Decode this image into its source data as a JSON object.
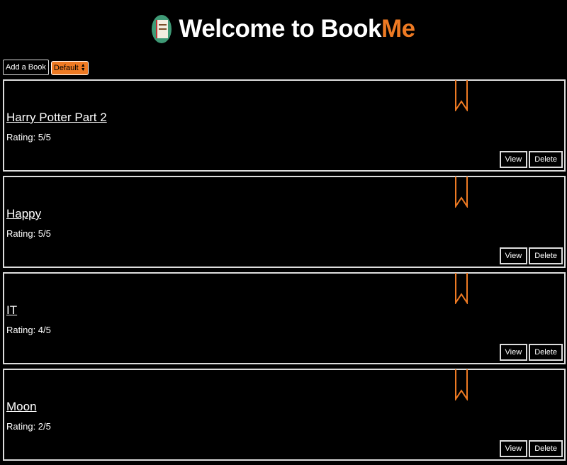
{
  "header": {
    "title_prefix": "Welcome to Book",
    "title_accent": "Me",
    "logo_icon": "book-logo-icon"
  },
  "controls": {
    "add_label": "Add a Book",
    "sort_value": "Default"
  },
  "books": [
    {
      "title": "Harry Potter Part 2",
      "rating": "Rating: 5/5",
      "view_label": "View",
      "delete_label": "Delete"
    },
    {
      "title": "Happy",
      "rating": "Rating: 5/5",
      "view_label": "View",
      "delete_label": "Delete"
    },
    {
      "title": "IT",
      "rating": "Rating: 4/5",
      "view_label": "View",
      "delete_label": "Delete"
    },
    {
      "title": "Moon",
      "rating": "Rating: 2/5",
      "view_label": "View",
      "delete_label": "Delete"
    }
  ],
  "colors": {
    "background": "#000000",
    "accent": "#ee7a23",
    "border": "#dddddd",
    "text": "#ffffff"
  }
}
